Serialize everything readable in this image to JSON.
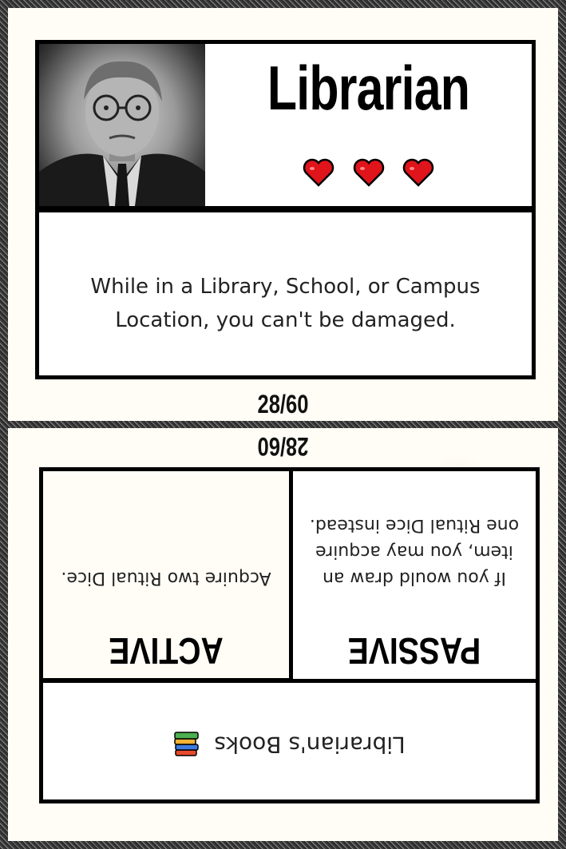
{
  "card": {
    "title": "Librarian",
    "hearts": 3,
    "description": "While in a Library, School, or Campus Location, you can't be damaged.",
    "counter": "28/60",
    "item_name": "Librarian's Books",
    "passive": {
      "title": "PASSIVE",
      "text": "If you would draw an item, you may acquire one Ritual Dice instead."
    },
    "active": {
      "title": "ACTIVE",
      "text": "Acquire two Ritual Dice."
    }
  },
  "icons": {
    "heart": "heart-icon",
    "books": "books-icon"
  },
  "colors": {
    "heart": "#e0141b",
    "border": "#000000",
    "paper": "#fffdf6"
  }
}
